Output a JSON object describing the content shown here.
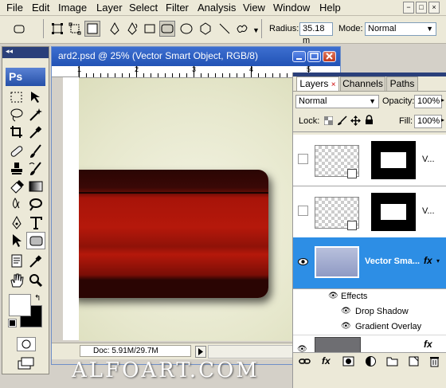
{
  "menu": {
    "items": [
      "File",
      "Edit",
      "Image",
      "Layer",
      "Select",
      "Filter",
      "Analysis",
      "View",
      "Window",
      "Help"
    ],
    "window_controls": [
      "−",
      "□",
      "×"
    ]
  },
  "options_bar": {
    "radius_label": "Radius:",
    "radius_value": "35.18 m",
    "mode_label": "Mode:",
    "mode_value": "Normal"
  },
  "tools_panel": {
    "logo": "Ps",
    "tools": [
      "marquee-tool",
      "move-tool",
      "lasso-tool",
      "magic-wand-tool",
      "crop-tool",
      "eyedropper-tool",
      "healing-brush-tool",
      "brush-tool",
      "clone-stamp-tool",
      "history-brush-tool",
      "eraser-tool",
      "gradient-tool",
      "blur-tool",
      "dodge-tool",
      "pen-tool",
      "type-tool",
      "path-selection-tool",
      "rounded-rectangle-tool",
      "notes-tool",
      "eyedropper-tool-2",
      "hand-tool",
      "zoom-tool"
    ]
  },
  "document": {
    "title": "ard2.psd @ 25% (Vector Smart Object, RGB/8)",
    "doc_info": "Doc: 5.91M/29.7M",
    "ruler_numbers": [
      "1",
      "2",
      "3",
      "4",
      "5"
    ]
  },
  "layers_panel": {
    "tabs": [
      "Layers",
      "Channels",
      "Paths"
    ],
    "tab_close": "×",
    "blend_mode": "Normal",
    "opacity_label": "Opacity:",
    "opacity_value": "100%",
    "lock_label": "Lock:",
    "fill_label": "Fill:",
    "fill_value": "100%",
    "layers": [
      {
        "name": "V...",
        "visible": false
      },
      {
        "name": "V...",
        "visible": false
      },
      {
        "name": "Vector Sma...",
        "visible": true,
        "selected": true,
        "fx": "fx"
      },
      {
        "name": "",
        "visible": true,
        "fx": "fx"
      }
    ],
    "effects_label": "Effects",
    "effects": [
      "Drop Shadow",
      "Gradient Overlay"
    ]
  },
  "colors": {
    "selection_blue": "#2d8ee5",
    "card_red": "#a81409",
    "card_dark": "#2a0503",
    "canvas_bg": "#e6e7cc"
  },
  "watermark": "ALFOART.COM"
}
